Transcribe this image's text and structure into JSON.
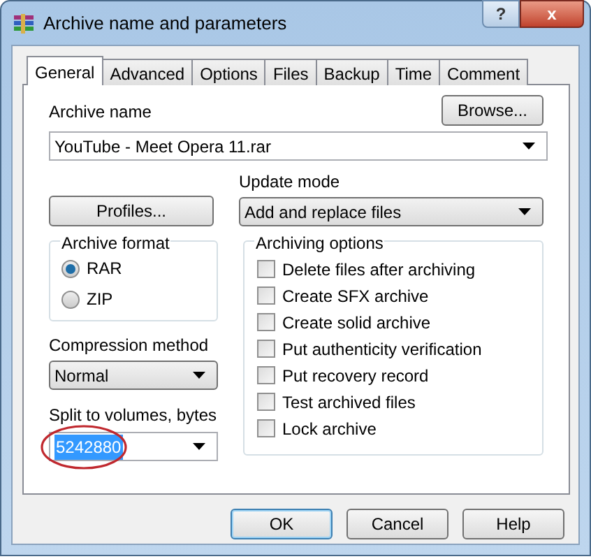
{
  "window": {
    "title": "Archive name and parameters",
    "help_button": "?",
    "close_button": "x"
  },
  "tabs": [
    {
      "label": "General",
      "selected": true
    },
    {
      "label": "Advanced",
      "selected": false
    },
    {
      "label": "Options",
      "selected": false
    },
    {
      "label": "Files",
      "selected": false
    },
    {
      "label": "Backup",
      "selected": false
    },
    {
      "label": "Time",
      "selected": false
    },
    {
      "label": "Comment",
      "selected": false
    }
  ],
  "archive_name": {
    "label": "Archive name",
    "value": "YouTube - Meet Opera 11.rar",
    "browse_button": "Browse..."
  },
  "profiles_button": "Profiles...",
  "update_mode": {
    "label": "Update mode",
    "value": "Add and replace files"
  },
  "archive_format": {
    "title": "Archive format",
    "options": [
      {
        "label": "RAR",
        "selected": true
      },
      {
        "label": "ZIP",
        "selected": false
      }
    ]
  },
  "compression_method": {
    "label": "Compression method",
    "value": "Normal"
  },
  "split_volumes": {
    "label": "Split to volumes, bytes",
    "value": "5242880",
    "text_selected": true
  },
  "archiving_options": {
    "title": "Archiving options",
    "options": [
      {
        "label": "Delete files after archiving",
        "checked": false
      },
      {
        "label": "Create SFX archive",
        "checked": false
      },
      {
        "label": "Create solid archive",
        "checked": false
      },
      {
        "label": "Put authenticity verification",
        "checked": false
      },
      {
        "label": "Put recovery record",
        "checked": false
      },
      {
        "label": "Test archived files",
        "checked": false
      },
      {
        "label": "Lock archive",
        "checked": false
      }
    ]
  },
  "buttons": [
    {
      "label": "OK",
      "default": true
    },
    {
      "label": "Cancel",
      "default": false
    },
    {
      "label": "Help",
      "default": false
    }
  ]
}
